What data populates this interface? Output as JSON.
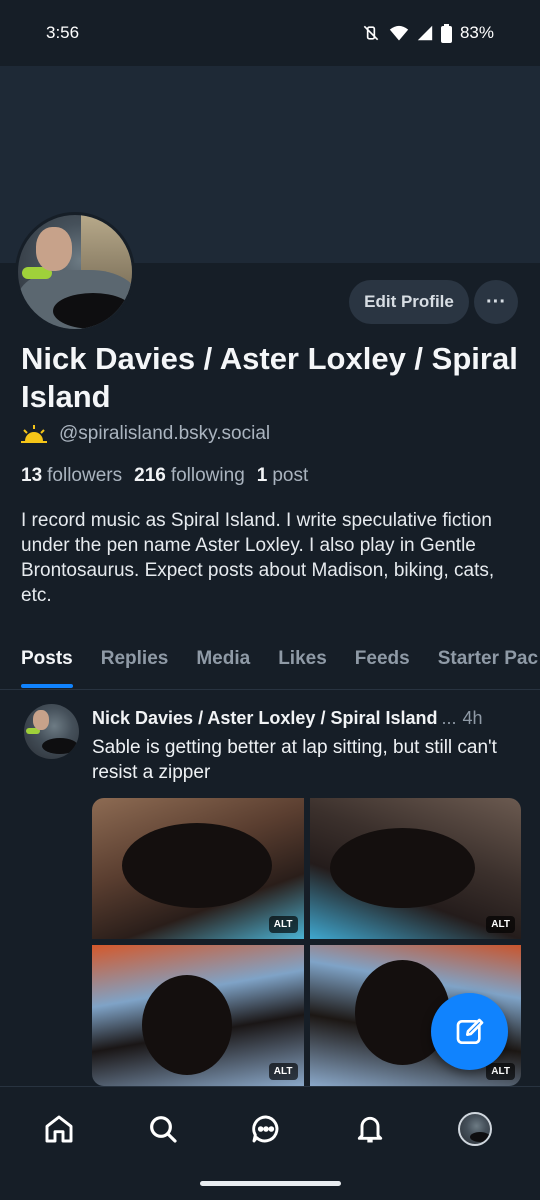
{
  "status_bar": {
    "time": "3:56",
    "battery": "83%",
    "icons": [
      "mute-vibrate-icon",
      "wifi-icon",
      "signal-icon",
      "battery-icon"
    ]
  },
  "profile": {
    "display_name": "Nick Davies / Aster Loxley / Spiral Island",
    "handle": "@spiralisland.bsky.social",
    "handle_emoji": "sunrise-icon",
    "followers_count": "13",
    "followers_label": "followers",
    "following_count": "216",
    "following_label": "following",
    "posts_count": "1",
    "posts_label": "post",
    "bio": "I record music as Spiral Island. I write speculative fiction under the pen name Aster Loxley. I also play in Gentle Brontosaurus. Expect posts about Madison, biking, cats, etc.",
    "edit_button": "Edit Profile",
    "more_button": "···"
  },
  "tabs": [
    {
      "label": "Posts",
      "active": true
    },
    {
      "label": "Replies"
    },
    {
      "label": "Media"
    },
    {
      "label": "Likes"
    },
    {
      "label": "Feeds"
    },
    {
      "label": "Starter Pac"
    }
  ],
  "post": {
    "author": "Nick Davies / Aster Loxley / Spiral Island",
    "truncation": "...",
    "time": "4h",
    "text": "Sable is getting better at lap sitting, but still can't resist a zipper",
    "image_alt_badges": [
      "ALT",
      "ALT",
      "ALT",
      "ALT"
    ]
  },
  "colors": {
    "accent": "#1083fe",
    "background": "#161e27",
    "banner": "#1e2936"
  },
  "bottom_nav": [
    "home-icon",
    "search-icon",
    "chat-icon",
    "bell-icon",
    "profile-avatar"
  ]
}
